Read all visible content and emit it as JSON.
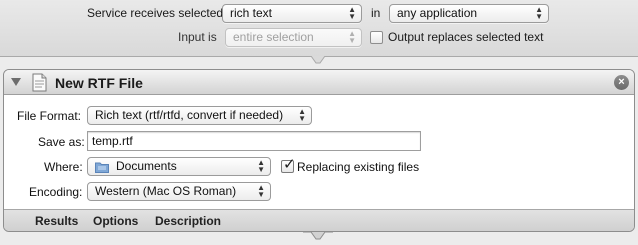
{
  "service": {
    "receives_label": "Service receives selected",
    "receives_value": "rich text",
    "in_label": "in",
    "in_value": "any application",
    "input_is_label": "Input is",
    "input_is_value": "entire selection",
    "output_replaces_label": "Output replaces selected text",
    "output_replaces_checked": false
  },
  "action": {
    "title": "New RTF File",
    "close_glyph": "×",
    "file_format_label": "File Format:",
    "file_format_value": "Rich text (rtf/rtfd, convert if needed)",
    "save_as_label": "Save as:",
    "save_as_value": "temp.rtf",
    "where_label": "Where:",
    "where_value": "Documents",
    "replacing_label": "Replacing existing files",
    "replacing_checked": true,
    "encoding_label": "Encoding:",
    "encoding_value": "Western (Mac OS Roman)",
    "tabs": [
      "Results",
      "Options",
      "Description"
    ]
  },
  "icons": {
    "updown": "▲▼",
    "check": "✓",
    "doc": "document-icon",
    "folder": "folder-icon"
  },
  "colors": {
    "workflow_bg": "#ececec",
    "panel_border": "#8d8d8d",
    "folder_blue": "#7fa7d6"
  }
}
